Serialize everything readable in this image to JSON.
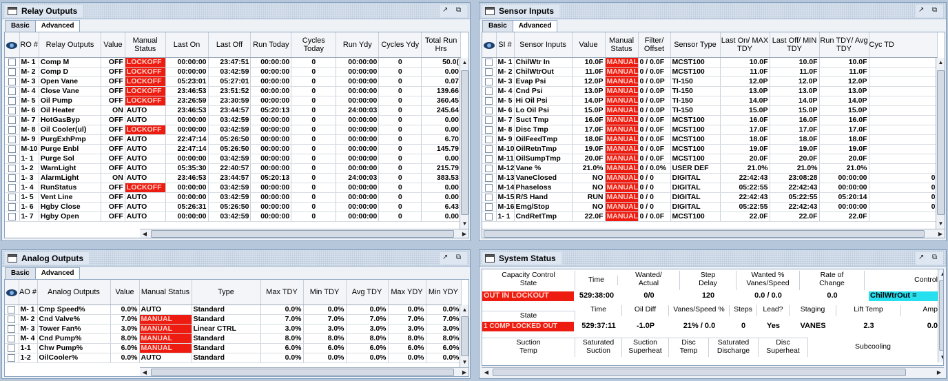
{
  "tabs": {
    "basic": "Basic",
    "advanced": "Advanced"
  },
  "relay": {
    "title": "Relay Outputs",
    "headers": [
      "RO #",
      "Relay Outputs",
      "Value",
      "Manual Status",
      "Last On",
      "Last Off",
      "Run Today",
      "Cycles Today",
      "Run Ydy",
      "Cycles Ydy",
      "Total Run Hrs"
    ],
    "rows": [
      [
        "M- 1",
        "Comp M",
        "OFF",
        "LOCKOFF",
        "00:00:00",
        "23:47:51",
        "00:00:00",
        "0",
        "00:00:00",
        "0",
        "50.0("
      ],
      [
        "M- 2",
        "Comp D",
        "OFF",
        "LOCKOFF",
        "00:00:00",
        "03:42:59",
        "00:00:00",
        "0",
        "00:00:00",
        "0",
        "0.00"
      ],
      [
        "M- 3",
        "Open Vane",
        "OFF",
        "LOCKOFF",
        "05:23:01",
        "05:27:01",
        "00:00:00",
        "0",
        "00:00:00",
        "0",
        "0.07"
      ],
      [
        "M- 4",
        "Close Vane",
        "OFF",
        "LOCKOFF",
        "23:46:53",
        "23:51:52",
        "00:00:00",
        "0",
        "00:00:00",
        "0",
        "139.66"
      ],
      [
        "M- 5",
        "Oil Pump",
        "OFF",
        "LOCKOFF",
        "23:26:59",
        "23:30:59",
        "00:00:00",
        "0",
        "00:00:00",
        "0",
        "360.45"
      ],
      [
        "M- 6",
        "Oil Heater",
        "ON",
        "AUTO",
        "23:46:53",
        "23:44:57",
        "05:20:13",
        "0",
        "24:00:03",
        "0",
        "245.64"
      ],
      [
        "M- 7",
        "HotGasByp",
        "OFF",
        "AUTO",
        "00:00:00",
        "03:42:59",
        "00:00:00",
        "0",
        "00:00:00",
        "0",
        "0.00"
      ],
      [
        "M- 8",
        "Oil Cooler(ul)",
        "OFF",
        "LOCKOFF",
        "00:00:00",
        "03:42:59",
        "00:00:00",
        "0",
        "00:00:00",
        "0",
        "0.00"
      ],
      [
        "M- 9",
        "PurgExhPmp",
        "OFF",
        "AUTO",
        "22:47:14",
        "05:26:50",
        "00:00:00",
        "0",
        "00:00:00",
        "0",
        "6.70"
      ],
      [
        "M-10",
        "Purge Enbl",
        "OFF",
        "AUTO",
        "22:47:14",
        "05:26:50",
        "00:00:00",
        "0",
        "00:00:00",
        "0",
        "145.79"
      ],
      [
        "1- 1",
        "Purge Sol",
        "OFF",
        "AUTO",
        "00:00:00",
        "03:42:59",
        "00:00:00",
        "0",
        "00:00:00",
        "0",
        "0.00"
      ],
      [
        "1- 2",
        "WarnLight",
        "OFF",
        "AUTO",
        "05:35:30",
        "22:40:57",
        "00:00:00",
        "0",
        "00:00:00",
        "0",
        "215.79"
      ],
      [
        "1- 3",
        "AlarmLight",
        "ON",
        "AUTO",
        "23:46:53",
        "23:44:57",
        "05:20:13",
        "0",
        "24:00:03",
        "0",
        "383.53"
      ],
      [
        "1- 4",
        "RunStatus",
        "OFF",
        "LOCKOFF",
        "00:00:00",
        "03:42:59",
        "00:00:00",
        "0",
        "00:00:00",
        "0",
        "0.00"
      ],
      [
        "1- 5",
        "Vent Line",
        "OFF",
        "AUTO",
        "00:00:00",
        "03:42:59",
        "00:00:00",
        "0",
        "00:00:00",
        "0",
        "0.00"
      ],
      [
        "1- 6",
        "Hgby Close",
        "OFF",
        "AUTO",
        "05:26:31",
        "05:26:50",
        "00:00:00",
        "0",
        "00:00:00",
        "0",
        "6.43"
      ],
      [
        "1- 7",
        "Hgby Open",
        "OFF",
        "AUTO",
        "00:00:00",
        "03:42:59",
        "00:00:00",
        "0",
        "00:00:00",
        "0",
        "0.00"
      ]
    ]
  },
  "sensor": {
    "title": "Sensor Inputs",
    "headers": [
      "SI #",
      "Sensor Inputs",
      "Value",
      "Manual Status",
      "Filter/ Offset",
      "Sensor Type",
      "Last On/ MAX TDY",
      "Last Off/ MIN TDY",
      "Run TDY/ Avg TDY",
      "Cyc TD"
    ],
    "rows": [
      [
        "M- 1",
        "ChilWtr In",
        "10.0F",
        "MANUAL",
        "0 / 0.0F",
        "MCST100",
        "10.0F",
        "10.0F",
        "10.0F",
        ""
      ],
      [
        "M- 2",
        "ChilWtrOut",
        "11.0F",
        "MANUAL",
        "0 / 0.0F",
        "MCST100",
        "11.0F",
        "11.0F",
        "11.0F",
        ""
      ],
      [
        "M- 3",
        "Evap Psi",
        "12.0P",
        "MANUAL",
        "0 / 0.0P",
        "TI-150",
        "12.0P",
        "12.0P",
        "12.0P",
        ""
      ],
      [
        "M- 4",
        "Cnd Psi",
        "13.0P",
        "MANUAL",
        "0 / 0.0P",
        "TI-150",
        "13.0P",
        "13.0P",
        "13.0P",
        ""
      ],
      [
        "M- 5",
        "Hi Oil Psi",
        "14.0P",
        "MANUAL",
        "0 / 0.0P",
        "TI-150",
        "14.0P",
        "14.0P",
        "14.0P",
        ""
      ],
      [
        "M- 6",
        "Lo Oil Psi",
        "15.0P",
        "MANUAL",
        "0 / 0.0P",
        "TI-150",
        "15.0P",
        "15.0P",
        "15.0P",
        ""
      ],
      [
        "M- 7",
        "Suct Tmp",
        "16.0F",
        "MANUAL",
        "0 / 0.0F",
        "MCST100",
        "16.0F",
        "16.0F",
        "16.0F",
        ""
      ],
      [
        "M- 8",
        "Disc Tmp",
        "17.0F",
        "MANUAL",
        "0 / 0.0F",
        "MCST100",
        "17.0F",
        "17.0F",
        "17.0F",
        ""
      ],
      [
        "M- 9",
        "OilFeedTmp",
        "18.0F",
        "MANUAL",
        "0 / 0.0F",
        "MCST100",
        "18.0F",
        "18.0F",
        "18.0F",
        ""
      ],
      [
        "M-10",
        "OilRetnTmp",
        "19.0F",
        "MANUAL",
        "0 / 0.0F",
        "MCST100",
        "19.0F",
        "19.0F",
        "19.0F",
        ""
      ],
      [
        "M-11",
        "OilSumpTmp",
        "20.0F",
        "MANUAL",
        "0 / 0.0F",
        "MCST100",
        "20.0F",
        "20.0F",
        "20.0F",
        ""
      ],
      [
        "M-12",
        "Vane %",
        "21.0%",
        "MANUAL",
        "0 / 0.0%",
        "USER DEF",
        "21.0%",
        "21.0%",
        "21.0%",
        ""
      ],
      [
        "M-13",
        "VaneClosed",
        "NO",
        "MANUAL",
        "0 / 0",
        "DIGITAL",
        "22:42:43",
        "23:08:28",
        "00:00:00",
        "0"
      ],
      [
        "M-14",
        "Phaseloss",
        "NO",
        "MANUAL",
        "0 / 0",
        "DIGITAL",
        "05:22:55",
        "22:42:43",
        "00:00:00",
        "0"
      ],
      [
        "M-15",
        "R/S Hand",
        "RUN",
        "MANUAL",
        "0 / 0",
        "DIGITAL",
        "22:42:43",
        "05:22:55",
        "05:20:14",
        "0"
      ],
      [
        "M-16",
        "Emg/Stop",
        "NO",
        "MANUAL",
        "0 / 0",
        "DIGITAL",
        "05:22:55",
        "22:42:43",
        "00:00:00",
        "0"
      ],
      [
        "1- 1",
        "CndRetTmp",
        "22.0F",
        "MANUAL",
        "0 / 0.0F",
        "MCST100",
        "22.0F",
        "22.0F",
        "22.0F",
        ""
      ]
    ]
  },
  "analog": {
    "title": "Analog Outputs",
    "headers": [
      "AO #",
      "Analog Outputs",
      "Value",
      "Manual Status",
      "Type",
      "Max TDY",
      "Min TDY",
      "Avg TDY",
      "Max YDY",
      "Min YDY"
    ],
    "rows": [
      [
        "M- 1",
        "Cmp Speed%",
        "0.0%",
        "AUTO",
        "Standard",
        "0.0%",
        "0.0%",
        "0.0%",
        "0.0%",
        "0.0%"
      ],
      [
        "M- 2",
        "Cnd Valve%",
        "7.0%",
        "MANUAL",
        "Standard",
        "7.0%",
        "7.0%",
        "7.0%",
        "7.0%",
        "7.0%"
      ],
      [
        "M- 3",
        "Tower Fan%",
        "3.0%",
        "MANUAL",
        "Linear CTRL",
        "3.0%",
        "3.0%",
        "3.0%",
        "3.0%",
        "3.0%"
      ],
      [
        "M- 4",
        "Cnd Pump%",
        "8.0%",
        "MANUAL",
        "Standard",
        "8.0%",
        "8.0%",
        "8.0%",
        "8.0%",
        "8.0%"
      ],
      [
        "1-1",
        "Chw Pump%",
        "6.0%",
        "MANUAL",
        "Standard",
        "6.0%",
        "6.0%",
        "6.0%",
        "6.0%",
        "6.0%"
      ],
      [
        "1-2",
        "OilCooler%",
        "0.0%",
        "AUTO",
        "Standard",
        "0.0%",
        "0.0%",
        "0.0%",
        "0.0%",
        "0.0%"
      ]
    ]
  },
  "system": {
    "title": "System Status",
    "row1_headers": [
      "Capacity Control State",
      "Time",
      "Wanted/ Actual",
      "Step Delay",
      "Wanted % Vanes/Speed",
      "Rate of Change",
      "Control"
    ],
    "row1_values": [
      "OUT IN LOCKOUT",
      "529:38:00",
      "0/0",
      "120",
      "0.0 / 0.0",
      "0.0",
      "ChilWtrOut ="
    ],
    "row2_headers": [
      "State",
      "Time",
      "Oil Diff",
      "Vanes/Speed %",
      "Steps",
      "Lead?",
      "Staging",
      "Lift Temp",
      "Amp"
    ],
    "row2_values": [
      "1 COMP LOCKED OUT",
      "529:37:11",
      "-1.0P",
      "21% / 0.0",
      "0",
      "Yes",
      "VANES",
      "2.3",
      "0.0"
    ],
    "row3_headers": [
      "Suction Temp",
      "Saturated Suction",
      "Suction Superheat",
      "Disc Temp",
      "Saturated Discharge",
      "Disc Superheat",
      "Subcooling"
    ]
  }
}
